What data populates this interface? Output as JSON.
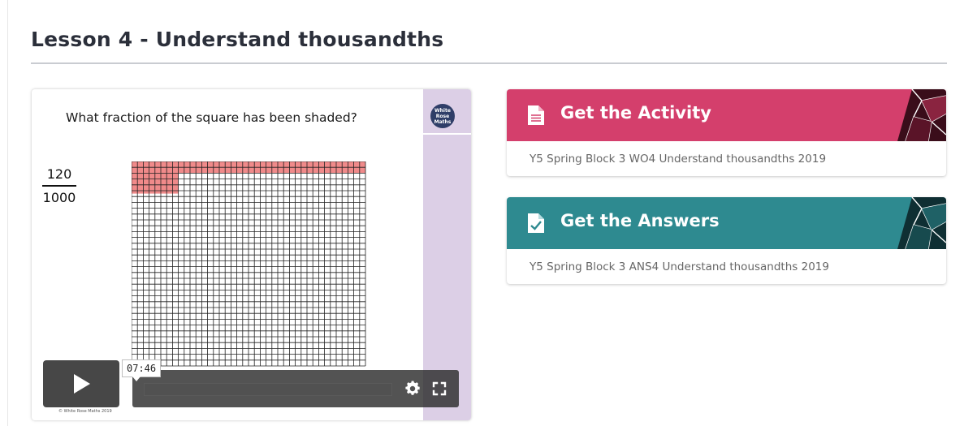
{
  "lesson": {
    "title": "Lesson 4 - Understand thousandths"
  },
  "video": {
    "question": "What fraction of the square has been shaded?",
    "fraction_numerator": "120",
    "fraction_denominator": "1000",
    "logo_text": "White Rose Maths",
    "copyright": "© White Rose Maths 2019",
    "timestamp": "07:46",
    "progress": 0.0,
    "grid": {
      "columns": 40,
      "rows": 35,
      "shaded_full_rows": 2,
      "shaded_extra_cells": 8
    }
  },
  "activity": {
    "label": "Get the Activity",
    "file": "Y5 Spring Block 3 WO4 Understand thousandths 2019",
    "color": "#d43f6c"
  },
  "answers": {
    "label": "Get the Answers",
    "file": "Y5 Spring Block 3 ANS4 Understand thousandths 2019",
    "color": "#2e8a90"
  }
}
